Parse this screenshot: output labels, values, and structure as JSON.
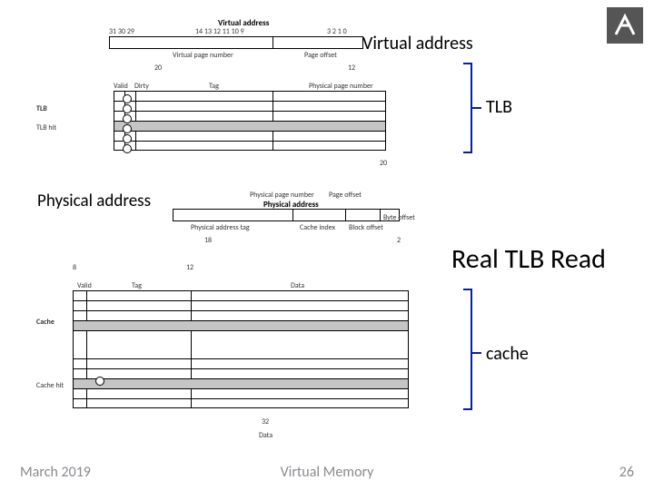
{
  "logo": {
    "alt": "university-logo"
  },
  "labels": {
    "virtual_address_overlay": "Virtual address",
    "tlb_overlay": "TLB",
    "physical_address_overlay": "Physical address",
    "real_tlb_read_overlay": "Real TLB Read",
    "cache_overlay": "cache"
  },
  "diagram": {
    "virtual_address_header": "Virtual address",
    "virtual_page_number": "Virtual page number",
    "page_offset": "Page offset",
    "valid": "Valid",
    "dirty": "Dirty",
    "tag": "Tag",
    "physical_page_number": "Physical page number",
    "tlb": "TLB",
    "tlb_hit": "TLB hit",
    "physical_address_header": "Physical address",
    "physical_address_tag": "Physical address tag",
    "cache_index": "Cache index",
    "block_offset": "Block offset",
    "byte_offset": "Byte offset",
    "cache": "Cache",
    "cache_hit": "Cache hit",
    "data": "Data",
    "bits_hi": "31 30 29",
    "bits_mid": "14 13 12 11 10 9",
    "bits_lo": "3 2 1 0",
    "w20": "20",
    "w12": "12",
    "w18": "18",
    "w8": "8",
    "w2": "2",
    "w32": "32"
  },
  "footer": {
    "left": "March 2019",
    "center": "Virtual Memory",
    "right": "26"
  }
}
